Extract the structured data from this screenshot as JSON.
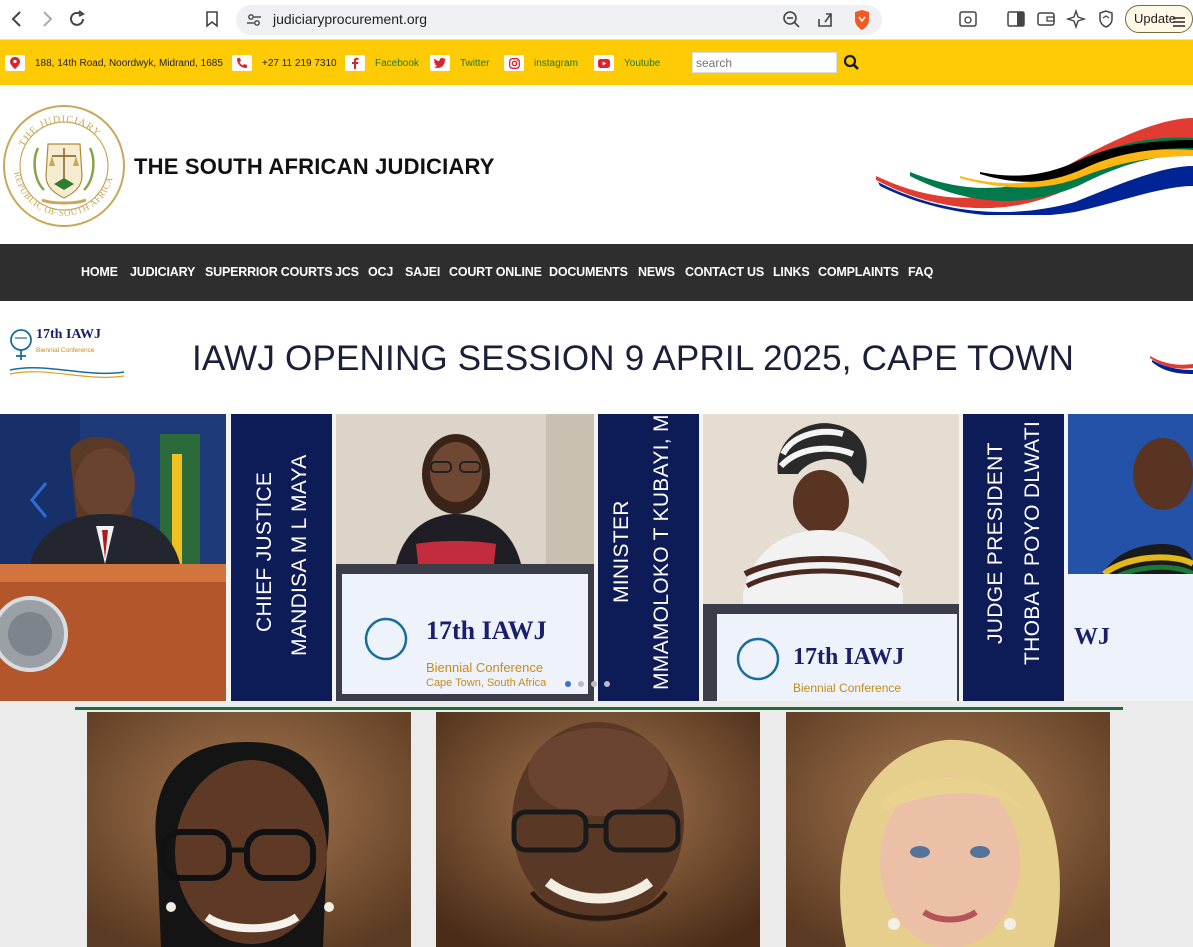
{
  "browser": {
    "url": "judiciaryprocurement.org",
    "update_label": "Update"
  },
  "topbar": {
    "address": "188, 14th Road, Noordwyk, Midrand, 1685",
    "phone": "+27 11 219 7310",
    "facebook": "Facebook",
    "twitter": "Twitter",
    "instagram": "instagram",
    "youtube": "Youtube",
    "search_placeholder": "search"
  },
  "header": {
    "title": "THE SOUTH AFRICAN JUDICIARY"
  },
  "nav": {
    "items": [
      "HOME",
      "JUDICIARY",
      "SUPERRIOR COURTS",
      "JCS",
      "OCJ",
      "SAJEI",
      "COURT ONLINE",
      "DOCUMENTS",
      "NEWS",
      "CONTACT US",
      "LINKS",
      "COMPLAINTS",
      "FAQ"
    ]
  },
  "banner": {
    "title": "IAWJ OPENING SESSION 9 APRIL 2025, CAPE TOWN",
    "logo_text": "17th IAWJ",
    "logo_sub": "Biennial Conference"
  },
  "carousel": {
    "panels": [
      {
        "line1": "CHIEF JUSTICE",
        "line2": "MANDISA M L MAYA"
      },
      {
        "line1": "MINISTER",
        "line2": "MMAMOLOKO T KUBAYI, MP"
      },
      {
        "line1": "JUDGE PRESIDENT",
        "line2": "THOBA P POYO DLWATI"
      }
    ],
    "podium_texts": {
      "big": "17th IAWJ",
      "conf": "Biennial Conference",
      "place": "Cape Town, South Africa"
    },
    "dots": 4,
    "active_dot": 0
  },
  "colors": {
    "topbar_yellow": "#ffcb05",
    "nav_dark": "#2e2e2e",
    "panel_navy": "#0d1b57",
    "accent_green": "#1e6b37"
  }
}
